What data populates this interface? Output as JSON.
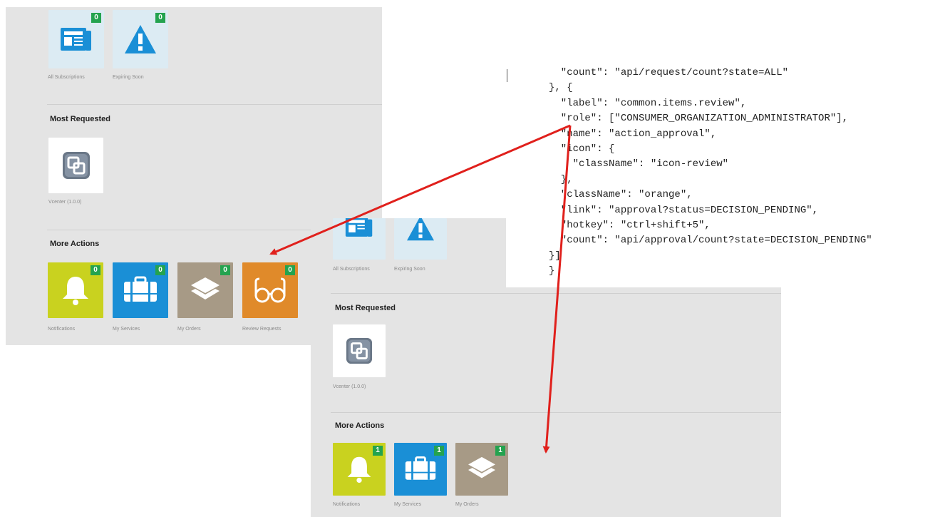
{
  "back_panel": {
    "subscriptions": [
      {
        "label": "All Subscriptions",
        "count": "0",
        "icon": "newspaper-icon"
      },
      {
        "label": "Expiring Soon",
        "count": "0",
        "icon": "warning-icon"
      }
    ],
    "most_requested": {
      "title": "Most Requested",
      "items": [
        {
          "label": "Vcenter (1.0.0)",
          "icon": "vcenter-icon"
        }
      ]
    },
    "more_actions": {
      "title": "More Actions",
      "items": [
        {
          "label": "Notifications",
          "count": "0",
          "icon": "bell-icon",
          "color": "#c9d21f"
        },
        {
          "label": "My Services",
          "count": "0",
          "icon": "briefcase-icon",
          "color": "#1a8fd6"
        },
        {
          "label": "My Orders",
          "count": "0",
          "icon": "layers-icon",
          "color": "#a79a86"
        },
        {
          "label": "Review Requests",
          "count": "0",
          "icon": "glasses-icon",
          "color": "#e08a2a"
        }
      ]
    }
  },
  "front_panel": {
    "subscriptions": [
      {
        "label": "All Subscriptions",
        "icon": "newspaper-icon"
      },
      {
        "label": "Expiring Soon",
        "icon": "warning-icon"
      }
    ],
    "most_requested": {
      "title": "Most Requested",
      "items": [
        {
          "label": "Vcenter (1.0.0)",
          "icon": "vcenter-icon"
        }
      ]
    },
    "more_actions": {
      "title": "More Actions",
      "items": [
        {
          "label": "Notifications",
          "count": "1",
          "icon": "bell-icon",
          "color": "#c9d21f"
        },
        {
          "label": "My Services",
          "count": "1",
          "icon": "briefcase-icon",
          "color": "#1a8fd6"
        },
        {
          "label": "My Orders",
          "count": "1",
          "icon": "layers-icon",
          "color": "#a79a86"
        }
      ]
    }
  },
  "code_lines": [
    "  \"count\": \"api/request/count?state=ALL\"",
    "}, {",
    "  \"label\": \"common.items.review\",",
    "  \"role\": [\"CONSUMER_ORGANIZATION_ADMINISTRATOR\"],",
    "  \"name\": \"action_approval\",",
    "  \"icon\": {",
    "    \"className\": \"icon-review\"",
    "  },",
    "  \"className\": \"orange\",",
    "  \"link\": \"approval?status=DECISION_PENDING\",",
    "  \"hotkey\": \"ctrl+shift+5\",",
    "  \"count\": \"api/approval/count?state=DECISION_PENDING\"",
    "}]",
    "}"
  ],
  "colors": {
    "arrow": "#e0201c",
    "badge": "#24a34f",
    "panel": "#e4e4e4",
    "tile_light": "#dcebf3",
    "icon_blue": "#1a8fd6"
  }
}
